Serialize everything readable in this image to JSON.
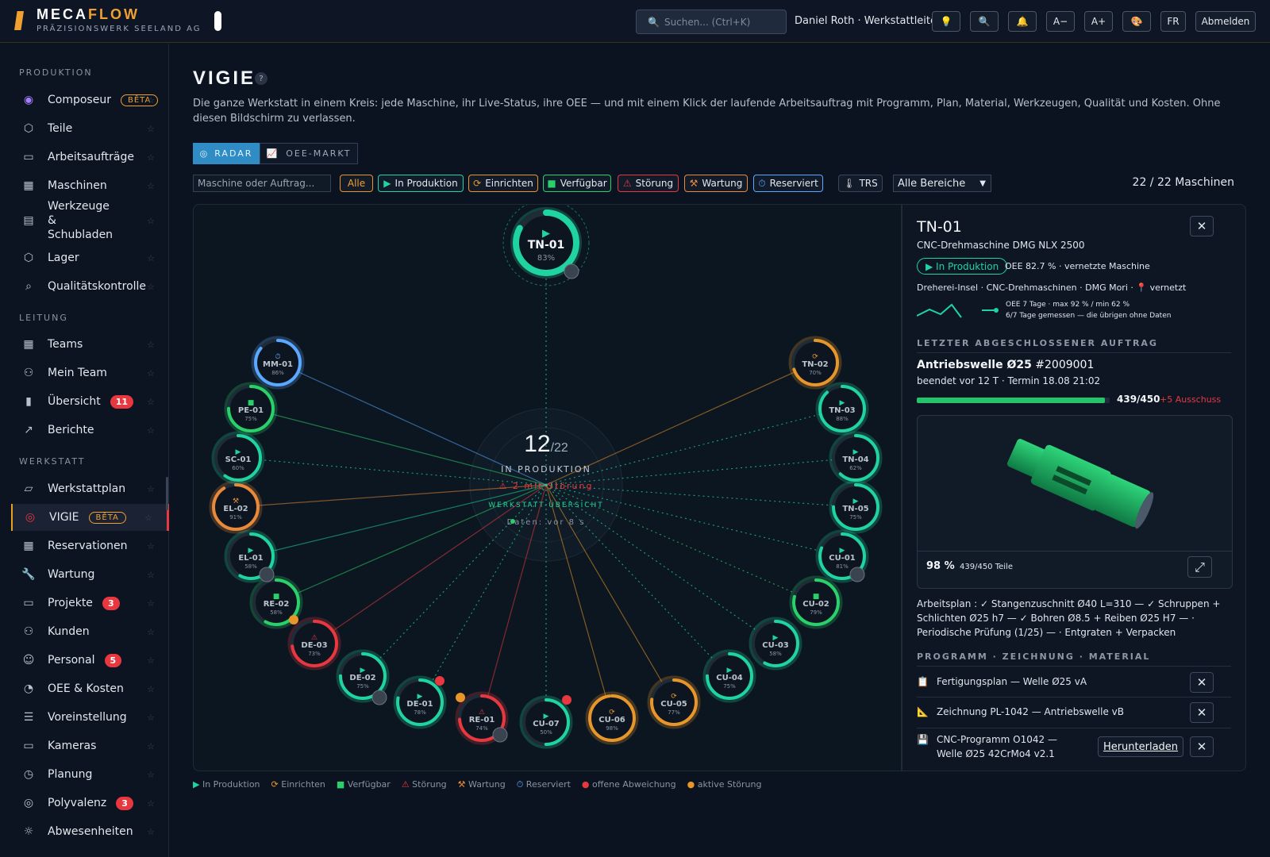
{
  "brand": {
    "name_a": "MECA",
    "name_b": "FLOW",
    "subtitle": "PRÄZISIONSWERK SEELAND AG"
  },
  "search": {
    "placeholder": "Suchen...  (Ctrl+K)"
  },
  "user": {
    "label": "Daniel Roth · Werkstattleiter"
  },
  "toolbar": {
    "font_minus": "A−",
    "font_plus": "A+",
    "lang": "FR",
    "logout": "Abmelden"
  },
  "sidebar": {
    "sections": [
      "PRODUKTION",
      "LEITUNG",
      "WERKSTATT"
    ],
    "items": [
      {
        "label": "Composeur",
        "badge": "BÊTA",
        "icon": "composer-icon"
      },
      {
        "label": "Teile",
        "icon": "cube-icon"
      },
      {
        "label": "Arbeitsaufträge",
        "icon": "clipboard-icon"
      },
      {
        "label": "Maschinen",
        "icon": "grid-icon"
      },
      {
        "label": "Werkzeuge & Schubladen",
        "icon": "drawer-icon"
      },
      {
        "label": "Lager",
        "icon": "box-icon"
      },
      {
        "label": "Qualitätskontrolle",
        "icon": "search-icon"
      },
      {
        "label": "Teams",
        "icon": "grid-icon"
      },
      {
        "label": "Mein Team",
        "icon": "users-icon"
      },
      {
        "label": "Übersicht",
        "badge": "11",
        "icon": "bar-chart-icon"
      },
      {
        "label": "Berichte",
        "icon": "trend-icon"
      },
      {
        "label": "Werkstattplan",
        "icon": "map-icon"
      },
      {
        "label": "VIGIE",
        "badge": "BÊTA",
        "icon": "target-icon"
      },
      {
        "label": "Reservationen",
        "icon": "calendar-icon"
      },
      {
        "label": "Wartung",
        "icon": "wrench-icon"
      },
      {
        "label": "Projekte",
        "badge": "3",
        "icon": "folder-icon"
      },
      {
        "label": "Kunden",
        "icon": "users-icon"
      },
      {
        "label": "Personal",
        "badge": "5",
        "icon": "person-icon"
      },
      {
        "label": "OEE & Kosten",
        "icon": "gauge-icon"
      },
      {
        "label": "Voreinstellung",
        "icon": "sliders-icon"
      },
      {
        "label": "Kameras",
        "icon": "monitor-icon"
      },
      {
        "label": "Planung",
        "icon": "clock-icon"
      },
      {
        "label": "Polyvalenz",
        "badge": "3",
        "icon": "rings-icon"
      },
      {
        "label": "Abwesenheiten",
        "icon": "sun-icon"
      }
    ]
  },
  "page": {
    "title": "VIGIE",
    "help": "?",
    "description": "Die ganze Werkstatt in einem Kreis: jede Maschine, ihr Live-Status, ihre OEE — und mit einem Klick der laufende Arbeitsauftrag mit Programm, Plan, Material, Werkzeugen, Qualität und Kosten. Ohne diesen Bildschirm zu verlassen.",
    "tabs": [
      "RADAR",
      "OEE-MARKT"
    ],
    "filter_placeholder": "Maschine oder Auftrag...",
    "chips": [
      "Alle",
      "In Produktion",
      "Einrichten",
      "Verfügbar",
      "Störung",
      "Wartung",
      "Reserviert",
      "TRS"
    ],
    "area_select": "Alle Bereiche",
    "count": "22 / 22 Maschinen"
  },
  "colors": {
    "prod": "#1fd4a0",
    "setup": "#e8962a",
    "avail": "#2ad06a",
    "fault": "#e8383f",
    "maint": "#e88a3a",
    "reserved": "#5aa8ff",
    "accent": "#f0a030"
  },
  "radar": {
    "center": {
      "count": "12",
      "total": "/22",
      "label": "IN PRODUKTION",
      "fault": "⚠ 2 mit Störung",
      "sub": "WERKSTATT-ÜBERSICHT",
      "data": "Daten: vor 8 s"
    },
    "machines": [
      {
        "id": "TN-01",
        "oee": "83%",
        "status": "prod"
      },
      {
        "id": "TN-02",
        "oee": "70%",
        "status": "setup"
      },
      {
        "id": "TN-03",
        "oee": "88%",
        "status": "prod"
      },
      {
        "id": "TN-04",
        "oee": "62%",
        "status": "prod"
      },
      {
        "id": "TN-05",
        "oee": "75%",
        "status": "prod"
      },
      {
        "id": "CU-01",
        "oee": "81%",
        "status": "prod"
      },
      {
        "id": "CU-02",
        "oee": "79%",
        "status": "avail"
      },
      {
        "id": "CU-03",
        "oee": "58%",
        "status": "prod"
      },
      {
        "id": "CU-04",
        "oee": "75%",
        "status": "prod"
      },
      {
        "id": "CU-05",
        "oee": "77%",
        "status": "setup"
      },
      {
        "id": "CU-06",
        "oee": "98%",
        "status": "setup"
      },
      {
        "id": "CU-07",
        "oee": "50%",
        "status": "prod"
      },
      {
        "id": "RE-01",
        "oee": "74%",
        "status": "fault"
      },
      {
        "id": "DE-01",
        "oee": "78%",
        "status": "prod"
      },
      {
        "id": "DE-02",
        "oee": "75%",
        "status": "prod"
      },
      {
        "id": "DE-03",
        "oee": "73%",
        "status": "fault"
      },
      {
        "id": "RE-02",
        "oee": "58%",
        "status": "avail"
      },
      {
        "id": "EL-01",
        "oee": "58%",
        "status": "prod"
      },
      {
        "id": "EL-02",
        "oee": "91%",
        "status": "maint"
      },
      {
        "id": "SC-01",
        "oee": "60%",
        "status": "prod"
      },
      {
        "id": "PE-01",
        "oee": "75%",
        "status": "avail"
      },
      {
        "id": "MM-01",
        "oee": "86%",
        "status": "reserved"
      }
    ]
  },
  "detail": {
    "id": "TN-01",
    "model": "CNC-Drehmaschine DMG NLX 2500",
    "status": "▶ In Produktion",
    "oee_text": "OEE 82.7 % · vernetzte Maschine",
    "location": "Dreherei-Insel · CNC-Drehmaschinen · DMG Mori · 📍 vernetzt",
    "spark_note1": "OEE 7 Tage · max 92 % / min 62 %",
    "spark_note2": "6/7 Tage gemessen — die übrigen ohne Daten",
    "last_order_head": "LETZTER ABGESCHLOSSENER AUFTRAG",
    "order_title": "Antriebswelle Ø25",
    "order_no": "#2009001",
    "order_meta": "beendet vor 12 T · Termin 18.08 21:02",
    "order_progress": 0.975,
    "order_count": "439/450",
    "scrap": "+5 Ausschuss",
    "preview_pct": "98 %",
    "preview_parts": "439/450 Teile",
    "workplan": "Arbeitsplan : ✓ Stangenzuschnitt Ø40 L=310 — ✓ Schruppen + Schlichten Ø25 h7 — ✓ Bohren Ø8.5 + Reiben Ø25 H7 — · Periodische Prüfung (1/25) — · Entgraten + Verpacken",
    "docs_head": "PROGRAMM · ZEICHNUNG · MATERIAL",
    "docs": [
      {
        "icon": "plan-icon",
        "label": "Fertigungsplan — Welle Ø25 vA"
      },
      {
        "icon": "drawing-icon",
        "label": "Zeichnung PL-1042 — Antriebswelle vB"
      },
      {
        "icon": "disk-icon",
        "label": "CNC-Programm O1042 — Welle Ø25 42CrMo4 v2.1",
        "action": "Herunterladen"
      }
    ]
  },
  "legend": [
    "▶ In Produktion",
    "⟳ Einrichten",
    "■ Verfügbar",
    "⚠ Störung",
    "⚒ Wartung",
    "⏱ Reserviert",
    "● offene Abweichung",
    "● aktive Störung"
  ]
}
